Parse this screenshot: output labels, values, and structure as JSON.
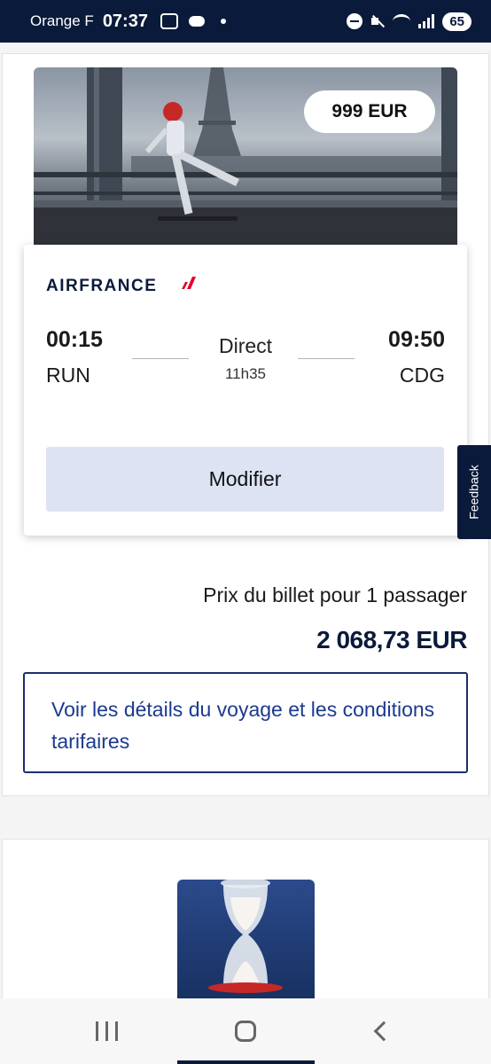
{
  "status_bar": {
    "carrier": "Orange F",
    "time": "07:37",
    "battery": "65"
  },
  "hero": {
    "price_badge": "999 EUR"
  },
  "flight": {
    "airline": "AIRFRANCE",
    "departure_time": "00:15",
    "departure_airport": "RUN",
    "arrival_time": "09:50",
    "arrival_airport": "CDG",
    "stops": "Direct",
    "duration": "11h35",
    "modify_label": "Modifier"
  },
  "feedback_label": "Feedback",
  "fare": {
    "label": "Prix du billet pour 1 passager",
    "amount": "2 068,73 EUR"
  },
  "details_link": "Voir les détails du voyage et les conditions tarifaires",
  "colors": {
    "brand_navy": "#0a1a3a",
    "link_blue": "#1b3a8f",
    "button_bg": "#dde3f3",
    "airfrance_red": "#e4002b"
  }
}
